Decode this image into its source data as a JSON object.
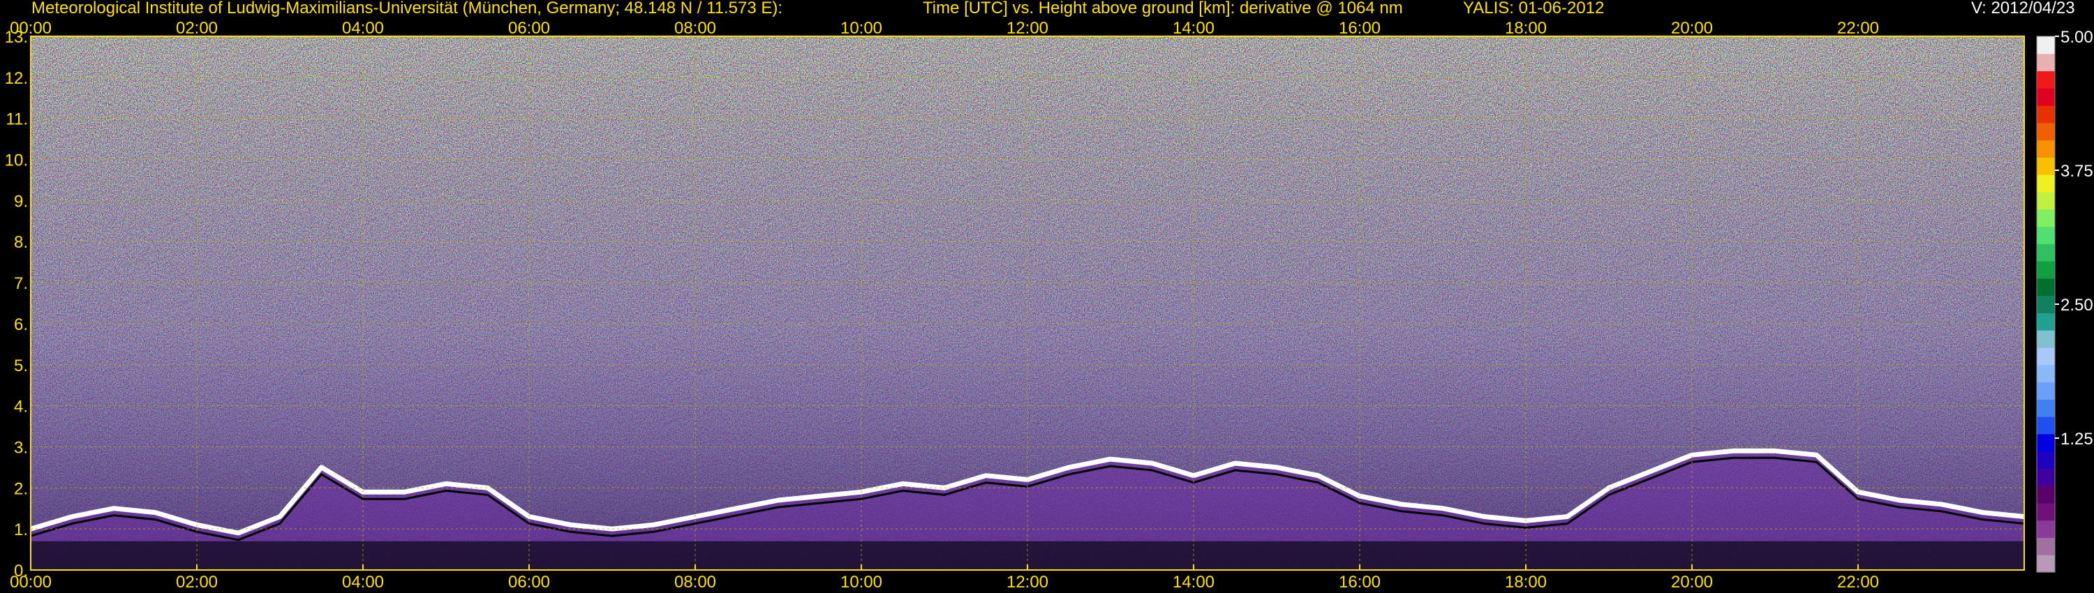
{
  "header": {
    "institute": "Meteorological Institute of Ludwig-Maximilians-Universität (München, Germany; 48.148 N / 11.573 E):",
    "description": "Time [UTC] vs. Height above ground [km]: derivative @ 1064 nm",
    "instrument_date": "YALIS: 01-06-2012",
    "version": "V: 2012/04/23"
  },
  "colors": {
    "label": "#ffe000",
    "label_white": "#ffffff",
    "grid": "#b8b000",
    "background": "#000000",
    "noise_light": "#d8d8d8",
    "noise_dark": "#2a2a2a",
    "layer_purple": "#6a2aa0",
    "layer_blue": "#4a6ad0"
  },
  "chart_data": {
    "type": "heatmap",
    "title": "Time [UTC] vs. Height above ground [km]: derivative @ 1064 nm",
    "xlabel": "",
    "ylabel": "",
    "x_ticks": [
      "00:00",
      "02:00",
      "04:00",
      "06:00",
      "08:00",
      "10:00",
      "12:00",
      "14:00",
      "16:00",
      "18:00",
      "20:00",
      "22:00"
    ],
    "x_range_hours": [
      0,
      24
    ],
    "y_ticks": [
      "0.",
      "1.",
      "2.",
      "3.",
      "4.",
      "5.",
      "6.",
      "7.",
      "8.",
      "9.",
      "10.",
      "11.",
      "12.",
      "13."
    ],
    "y_range_km": [
      0,
      13
    ],
    "grid": true,
    "colorbar": {
      "ticks": [
        "5.00",
        "3.75",
        "2.50",
        "1.25"
      ],
      "tick_values": [
        5.0,
        3.75,
        2.5,
        1.25
      ],
      "range": [
        0,
        5
      ],
      "colors_bottom_to_top": [
        "#b89ab8",
        "#a070a0",
        "#8a3a9a",
        "#70107a",
        "#5a006a",
        "#4000a0",
        "#2000c0",
        "#0000e0",
        "#2050f0",
        "#4080f0",
        "#6aa0f8",
        "#8ab8f8",
        "#a8c8f8",
        "#80c0d0",
        "#20a090",
        "#108060",
        "#007030",
        "#10a040",
        "#30c060",
        "#50e070",
        "#80f060",
        "#c0f040",
        "#f0f020",
        "#f8c000",
        "#f89000",
        "#f06000",
        "#e83000",
        "#e00020",
        "#f01818",
        "#e8b0b0",
        "#f0f0f0"
      ]
    },
    "boundary_layer_top_km": {
      "x_hours": [
        0.0,
        0.5,
        1.0,
        1.5,
        2.0,
        2.5,
        3.0,
        3.5,
        4.0,
        4.5,
        5.0,
        5.5,
        6.0,
        6.5,
        7.0,
        7.5,
        8.0,
        8.5,
        9.0,
        9.5,
        10.0,
        10.5,
        11.0,
        11.5,
        12.0,
        12.5,
        13.0,
        13.5,
        14.0,
        14.5,
        15.0,
        15.5,
        16.0,
        16.5,
        17.0,
        17.5,
        18.0,
        18.5,
        19.0,
        19.5,
        20.0,
        20.5,
        21.0,
        21.5,
        22.0,
        22.5,
        23.0,
        23.5,
        24.0
      ],
      "height_km": [
        1.0,
        1.3,
        1.5,
        1.4,
        1.1,
        0.9,
        1.3,
        2.5,
        1.9,
        1.9,
        2.1,
        2.0,
        1.3,
        1.1,
        1.0,
        1.1,
        1.3,
        1.5,
        1.7,
        1.8,
        1.9,
        2.1,
        2.0,
        2.3,
        2.2,
        2.5,
        2.7,
        2.6,
        2.3,
        2.6,
        2.5,
        2.3,
        1.8,
        1.6,
        1.5,
        1.3,
        1.2,
        1.3,
        2.0,
        2.4,
        2.8,
        2.9,
        2.9,
        2.8,
        1.9,
        1.7,
        1.6,
        1.4,
        1.3
      ]
    }
  }
}
